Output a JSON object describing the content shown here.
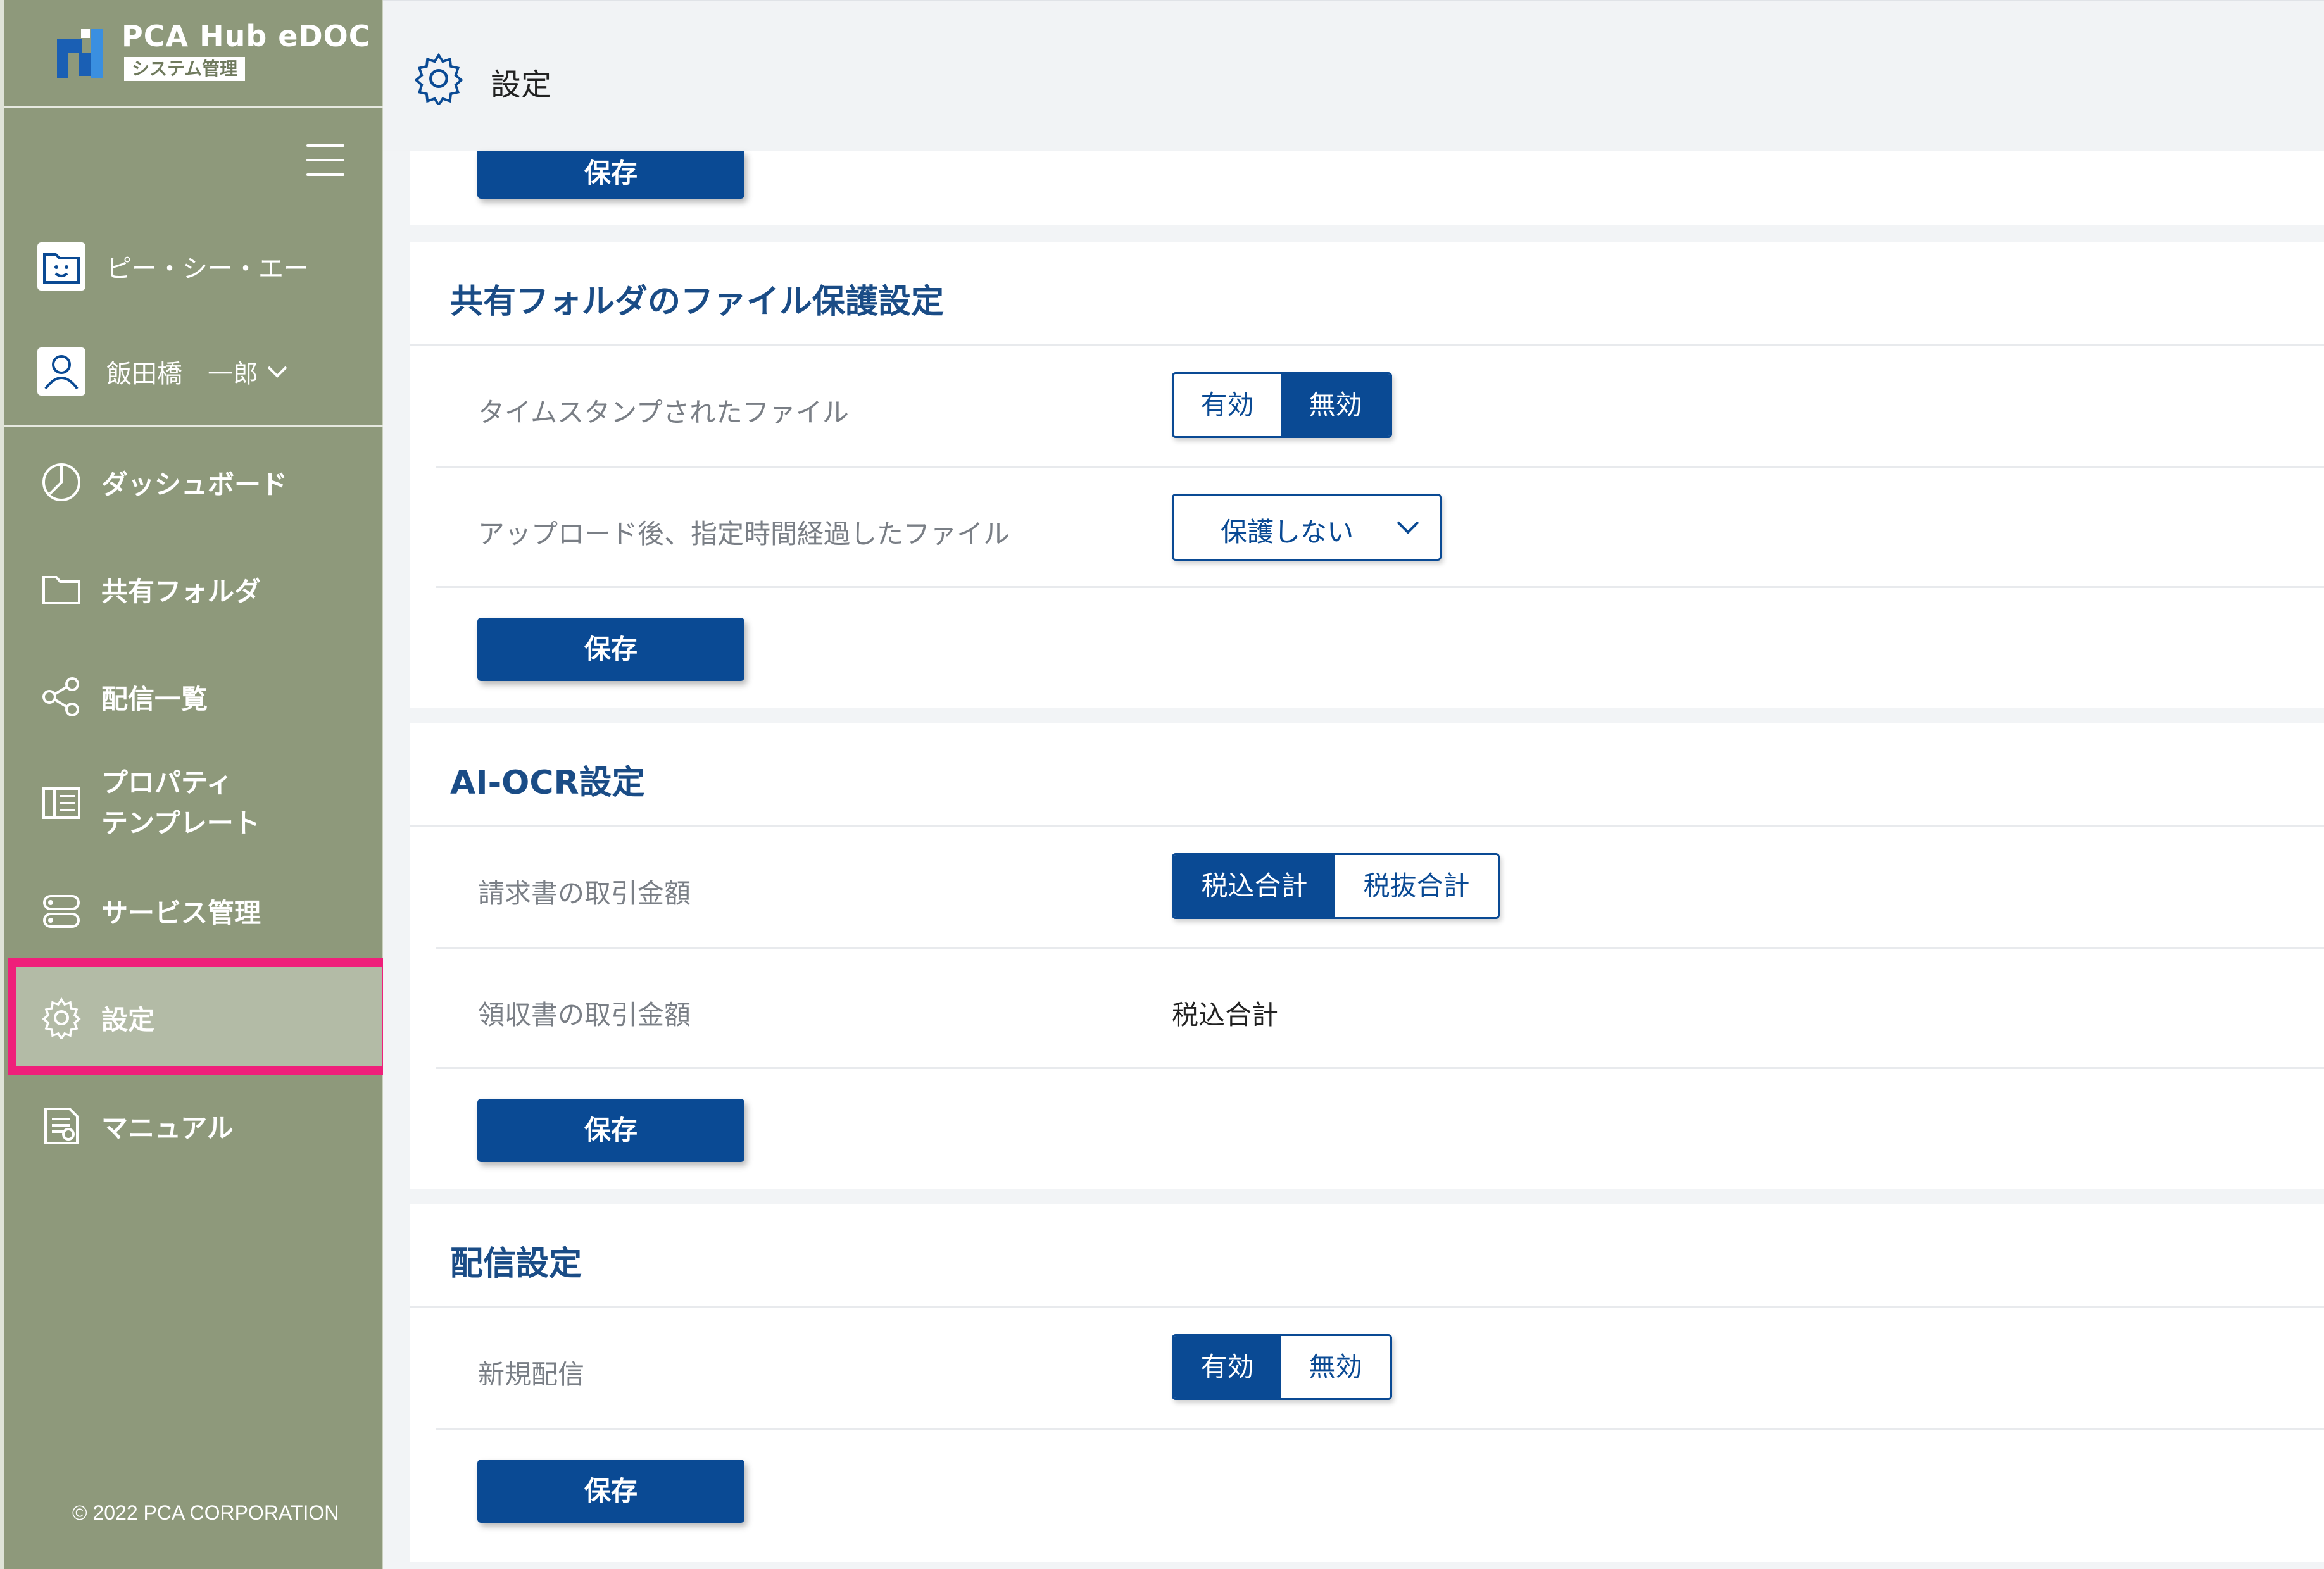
{
  "app": {
    "logo_title": "PCA Hub eDOC",
    "logo_badge": "システム管理"
  },
  "sidebar": {
    "company": "ピー・シー・エー",
    "user": "飯田橋　一郎",
    "items": [
      {
        "label": "ダッシュボード",
        "icon": "dashboard-pie-icon"
      },
      {
        "label": "共有フォルダ",
        "icon": "folder-icon"
      },
      {
        "label": "配信一覧",
        "icon": "share-icon"
      },
      {
        "label_line1": "プロパティ",
        "label_line2": "テンプレート",
        "icon": "template-icon"
      },
      {
        "label": "サービス管理",
        "icon": "service-icon"
      },
      {
        "label": "設定",
        "icon": "gear-icon",
        "active": true
      },
      {
        "label": "マニュアル",
        "icon": "manual-icon"
      }
    ],
    "copyright": "© 2022 PCA CORPORATION"
  },
  "header": {
    "title": "設定"
  },
  "save_label": "保存",
  "sections": {
    "file_protection": {
      "title": "共有フォルダのファイル保護設定",
      "rows": [
        {
          "label": "タイムスタンプされたファイル",
          "options": [
            "有効",
            "無効"
          ],
          "selected": "無効"
        },
        {
          "label": "アップロード後、指定時間経過したファイル",
          "dropdown_value": "保護しない"
        }
      ]
    },
    "ai_ocr": {
      "title": "AI-OCR設定",
      "rows": [
        {
          "label": "請求書の取引金額",
          "options": [
            "税込合計",
            "税抜合計"
          ],
          "selected": "税込合計"
        },
        {
          "label": "領収書の取引金額",
          "value": "税込合計"
        }
      ]
    },
    "delivery": {
      "title": "配信設定",
      "rows": [
        {
          "label": "新規配信",
          "options": [
            "有効",
            "無効"
          ],
          "selected": "有効"
        }
      ]
    }
  },
  "colors": {
    "sidebar_bg": "#8e997b",
    "primary": "#0a4a94",
    "heading": "#1a4c86",
    "active_outline": "#ef1f7a"
  }
}
